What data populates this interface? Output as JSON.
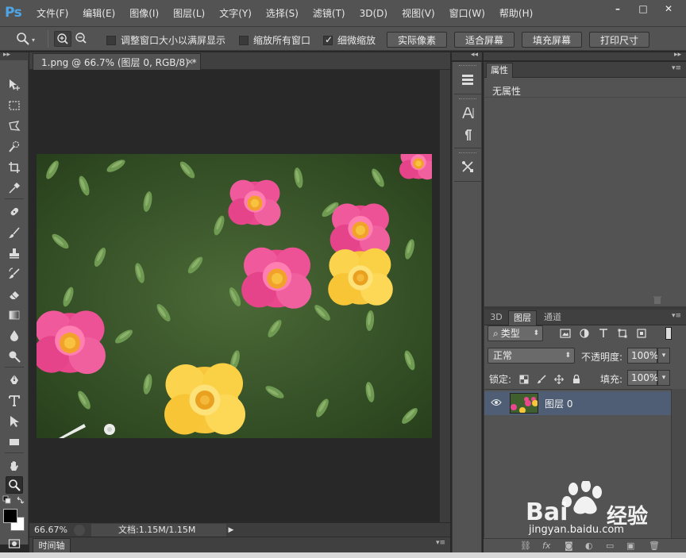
{
  "app": {
    "logo": "Ps",
    "menu": [
      "文件(F)",
      "编辑(E)",
      "图像(I)",
      "图层(L)",
      "文字(Y)",
      "选择(S)",
      "滤镜(T)",
      "3D(D)",
      "视图(V)",
      "窗口(W)",
      "帮助(H)"
    ],
    "window_controls": [
      "–",
      "□",
      "✕"
    ]
  },
  "options": {
    "checkbox_resize": {
      "label": "调整窗口大小以满屏显示",
      "checked": false
    },
    "checkbox_zoom_all": {
      "label": "缩放所有窗口",
      "checked": false
    },
    "checkbox_scrubby": {
      "label": "细微缩放",
      "checked": true
    },
    "btn_actual": "实际像素",
    "btn_fit": "适合屏幕",
    "btn_fill": "填充屏幕",
    "btn_print": "打印尺寸"
  },
  "document": {
    "tab_title": "1.png @ 66.7% (图层 0, RGB/8) *",
    "close_glyph": "×",
    "zoom": "66.67%",
    "doc_info": "文档:1.15M/1.15M",
    "timeline_tab": "时间轴"
  },
  "properties": {
    "tab": "属性",
    "empty_text": "无属性"
  },
  "layers": {
    "tabs": [
      "3D",
      "图层",
      "通道"
    ],
    "filter_kind": "类型",
    "blend_mode": "正常",
    "opacity_label": "不透明度:",
    "opacity": "100%",
    "lock_label": "锁定:",
    "fill_label": "填充:",
    "fill": "100%",
    "items": [
      {
        "name": "图层 0",
        "visible": true
      }
    ]
  },
  "watermark": {
    "brand": "Bai",
    "brand_cn": "经验",
    "url": "jingyan.baidu.com"
  },
  "colors": {
    "chrome": "#535353",
    "canvas_bg": "#282828",
    "ps_blue": "#4ea6e8",
    "layer_selected": "#4f5e74"
  }
}
